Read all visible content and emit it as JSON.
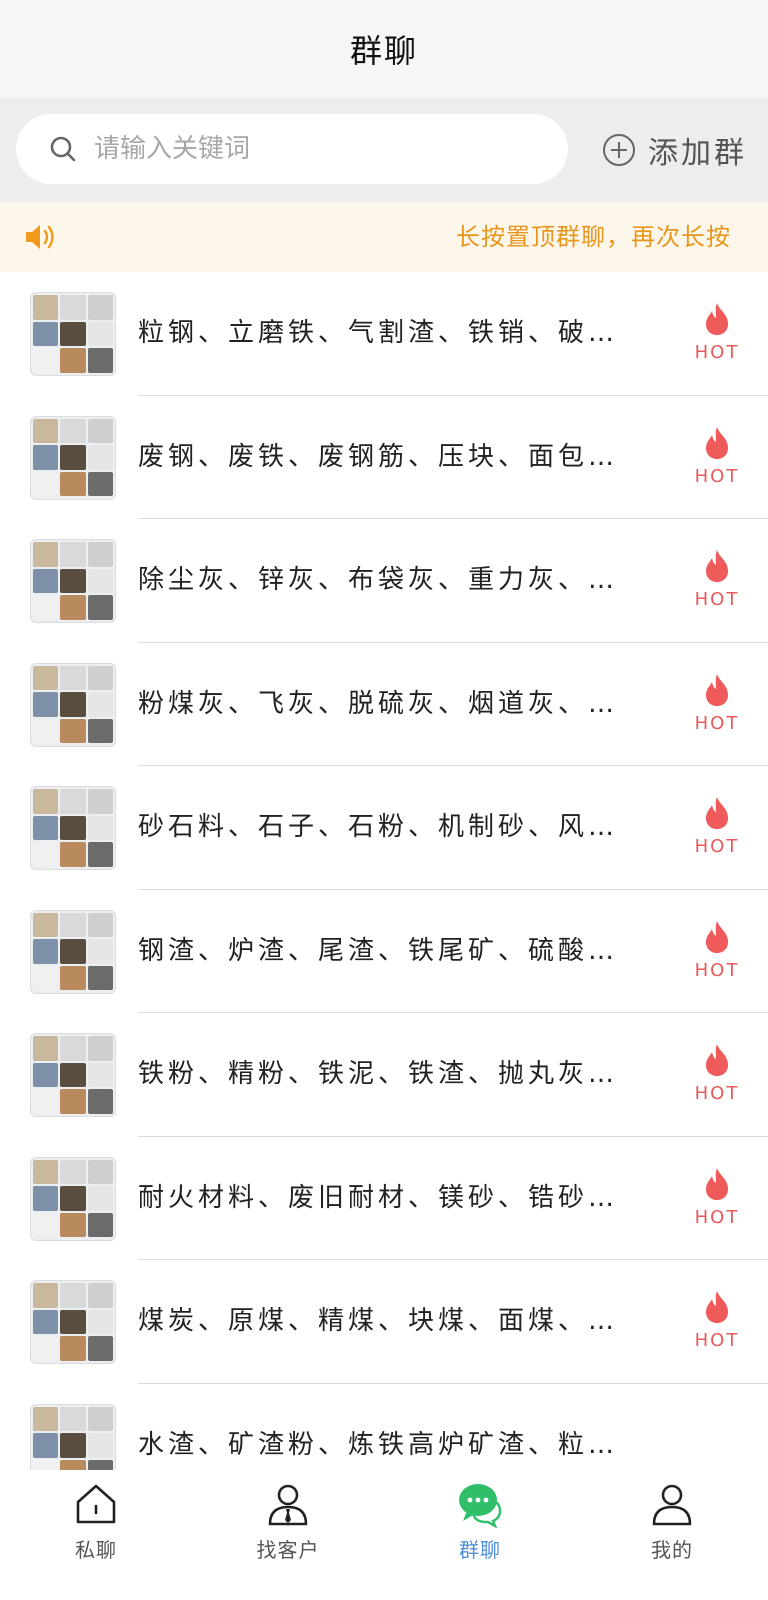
{
  "header": {
    "title": "群聊"
  },
  "search": {
    "placeholder": "请输入关键词",
    "value": ""
  },
  "add_group": {
    "label": "添加群"
  },
  "notice": {
    "text": "长按置顶群聊，再次长按"
  },
  "colors": {
    "accent": "#4f8fd6",
    "hot": "#e85a5a",
    "notice_text": "#e8961e",
    "chat_green": "#2fbf6a"
  },
  "groups": [
    {
      "name": "粒钢、立磨铁、气割渣、铁销、破…",
      "badge": "HOT"
    },
    {
      "name": "废钢、废铁、废钢筋、压块、面包…",
      "badge": "HOT"
    },
    {
      "name": "除尘灰、锌灰、布袋灰、重力灰、…",
      "badge": "HOT"
    },
    {
      "name": "粉煤灰、飞灰、脱硫灰、烟道灰、…",
      "badge": "HOT"
    },
    {
      "name": "砂石料、石子、石粉、机制砂、风…",
      "badge": "HOT"
    },
    {
      "name": "钢渣、炉渣、尾渣、铁尾矿、硫酸…",
      "badge": "HOT"
    },
    {
      "name": "铁粉、精粉、铁泥、铁渣、抛丸灰…",
      "badge": "HOT"
    },
    {
      "name": "耐火材料、废旧耐材、镁砂、锆砂…",
      "badge": "HOT"
    },
    {
      "name": "煤炭、原煤、精煤、块煤、面煤、…",
      "badge": "HOT"
    },
    {
      "name": "水渣、矿渣粉、炼铁高炉矿渣、粒…",
      "badge": ""
    }
  ],
  "tabs": [
    {
      "label": "私聊",
      "icon": "home-icon"
    },
    {
      "label": "找客户",
      "icon": "customer-icon"
    },
    {
      "label": "群聊",
      "icon": "chat-bubble-icon",
      "active": true
    },
    {
      "label": "我的",
      "icon": "person-icon"
    }
  ]
}
